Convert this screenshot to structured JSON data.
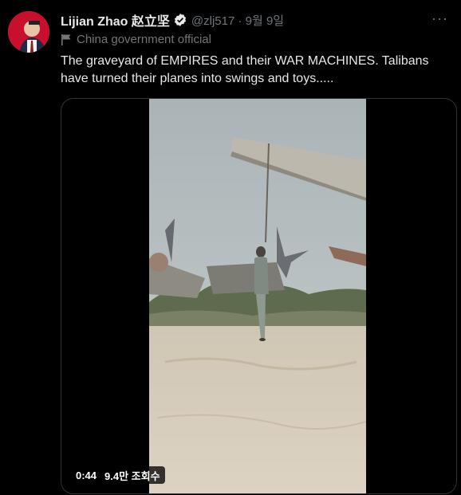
{
  "user": {
    "display_name": "Lijian Zhao 赵立坚",
    "handle_meta": "@zlj517 · 9월 9일",
    "label": "China government official"
  },
  "tweet": {
    "text": "The graveyard of EMPIRES and their WAR MACHINES. Talibans have turned their planes into swings and toys....."
  },
  "media": {
    "duration": "0:44",
    "views": "9.4만 조회수"
  },
  "icons": {
    "verified": "verified-badge-icon",
    "flag": "government-flag-icon",
    "more": "more-icon"
  },
  "colors": {
    "background": "#000000",
    "text": "#e7e9ea",
    "muted": "#71767b"
  }
}
